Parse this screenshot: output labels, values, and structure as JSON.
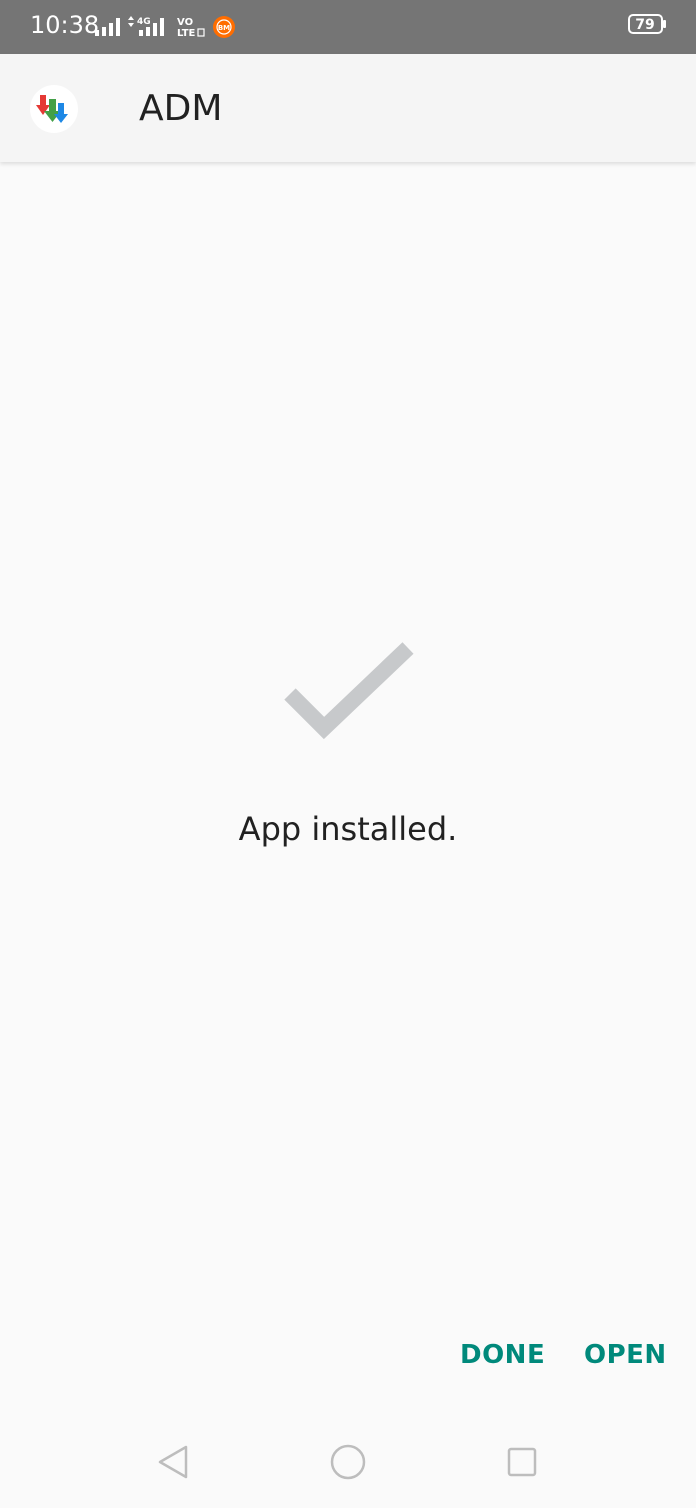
{
  "status_bar": {
    "time": "10:38",
    "network_4g": "4G",
    "volte": "VO\nLTE",
    "notification_badge": "BM",
    "battery_level": "79"
  },
  "app_bar": {
    "title": "ADM",
    "icon": "adm-download-arrows-icon"
  },
  "content": {
    "icon": "checkmark-icon",
    "message": "App installed."
  },
  "actions": {
    "done_label": "DONE",
    "open_label": "OPEN"
  },
  "nav_bar": {
    "back_icon": "back-triangle-icon",
    "home_icon": "home-circle-icon",
    "recents_icon": "recents-square-icon"
  },
  "colors": {
    "status_bar_bg": "#757575",
    "app_bar_bg": "#f5f5f5",
    "background": "#fafafa",
    "accent": "#00897b",
    "checkmark": "#c7c9cb"
  }
}
